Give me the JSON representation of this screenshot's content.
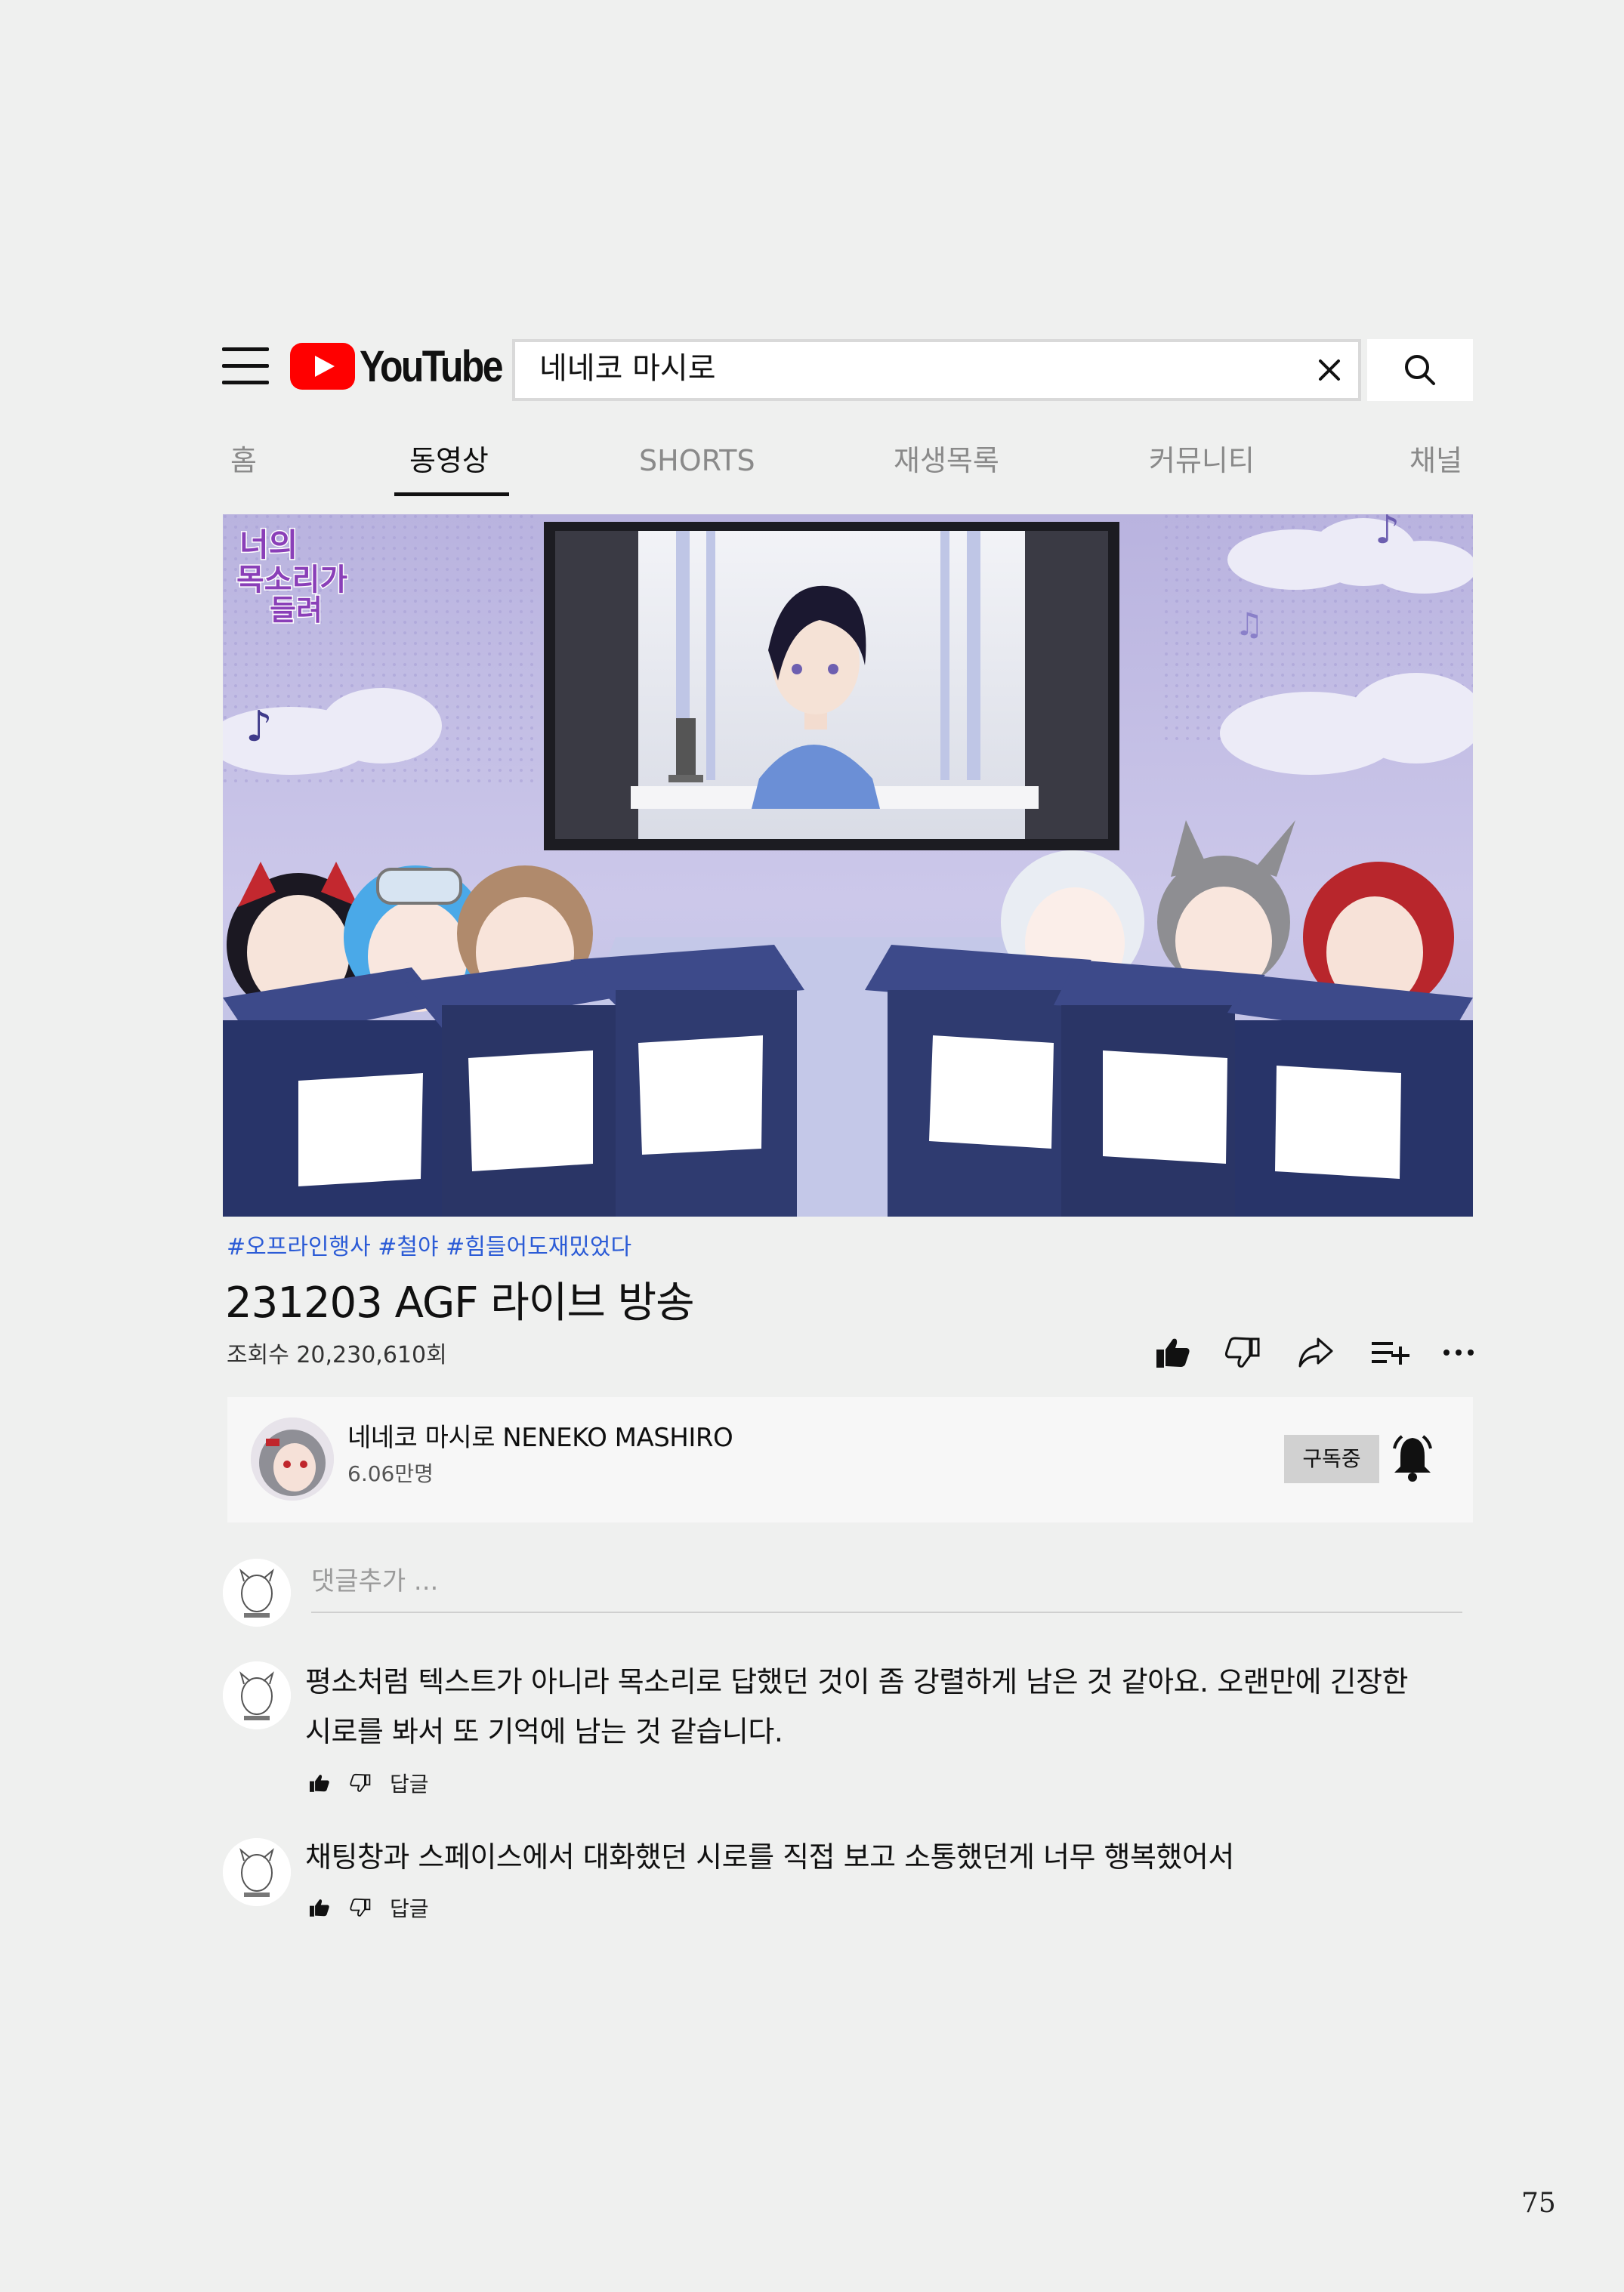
{
  "header": {
    "logo_text": "YouTube",
    "search_value": "네네코 마시로"
  },
  "tabs": [
    {
      "label": "홈",
      "active": false
    },
    {
      "label": "동영상",
      "active": true
    },
    {
      "label": "SHORTS",
      "active": false
    },
    {
      "label": "재생목록",
      "active": false
    },
    {
      "label": "커뮤니티",
      "active": false
    },
    {
      "label": "채널",
      "active": false
    }
  ],
  "thumbnail": {
    "overlay_title_line1": "너의",
    "overlay_title_line2": "목소리가",
    "overlay_title_line3": "들려"
  },
  "video": {
    "hashtags": "#오프라인행사 #철야 #힘들어도재밌었다",
    "title": "231203 AGF 라이브 방송",
    "views": "조회수 20,230,610회"
  },
  "channel": {
    "name": "네네코 마시로 NENEKO MASHIRO",
    "subscribers": "6.06만명",
    "subscribe_label": "구독중"
  },
  "comments": {
    "add_placeholder": "댓글추가 ...",
    "items": [
      {
        "line1": "평소처럼 텍스트가 아니라 목소리로 답했던 것이 좀 강렬하게 남은 것 같아요. 오랜만에 긴장한",
        "line2": "시로를 봐서 또 기억에 남는 것 같습니다.",
        "reply_label": "답글"
      },
      {
        "line1": "채팅창과 스페이스에서 대화했던 시로를 직접 보고 소통했던게 너무 행복했어서",
        "reply_label": "답글"
      }
    ]
  },
  "page_number": "75",
  "colors": {
    "background": "#eff0ef",
    "youtube_red": "#ff0000",
    "hashtag_blue": "#2b5bd6",
    "thumbnail_lavender": "#c7c2e6",
    "desk_navy": "#2a3566"
  }
}
